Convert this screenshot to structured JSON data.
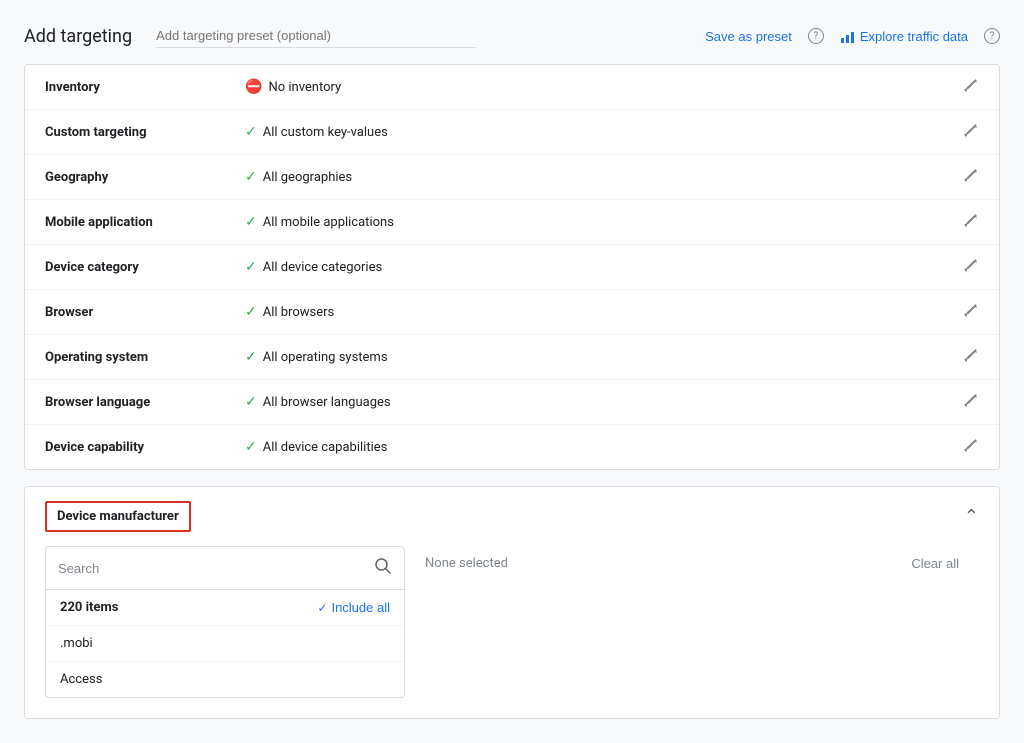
{
  "page": {
    "title": "Add targeting",
    "preset_placeholder": "Add targeting preset (optional)",
    "save_preset_label": "Save as preset",
    "explore_label": "Explore traffic data"
  },
  "targeting_rows": [
    {
      "label": "Inventory",
      "icon_type": "no",
      "value": "No inventory"
    },
    {
      "label": "Custom targeting",
      "icon_type": "check",
      "value": "All custom key-values"
    },
    {
      "label": "Geography",
      "icon_type": "check",
      "value": "All geographies"
    },
    {
      "label": "Mobile application",
      "icon_type": "check",
      "value": "All mobile applications"
    },
    {
      "label": "Device category",
      "icon_type": "check",
      "value": "All device categories"
    },
    {
      "label": "Browser",
      "icon_type": "check",
      "value": "All browsers"
    },
    {
      "label": "Operating system",
      "icon_type": "check",
      "value": "All operating systems"
    },
    {
      "label": "Browser language",
      "icon_type": "check",
      "value": "All browser languages"
    },
    {
      "label": "Device capability",
      "icon_type": "check",
      "value": "All device capabilities"
    }
  ],
  "device_manufacturer": {
    "title": "Device manufacturer",
    "search_placeholder": "Search",
    "items_count": "220 items",
    "include_all_label": "Include all",
    "none_selected_label": "None selected",
    "clear_all_label": "Clear all",
    "list_items": [
      ".mobi",
      "Access"
    ]
  }
}
